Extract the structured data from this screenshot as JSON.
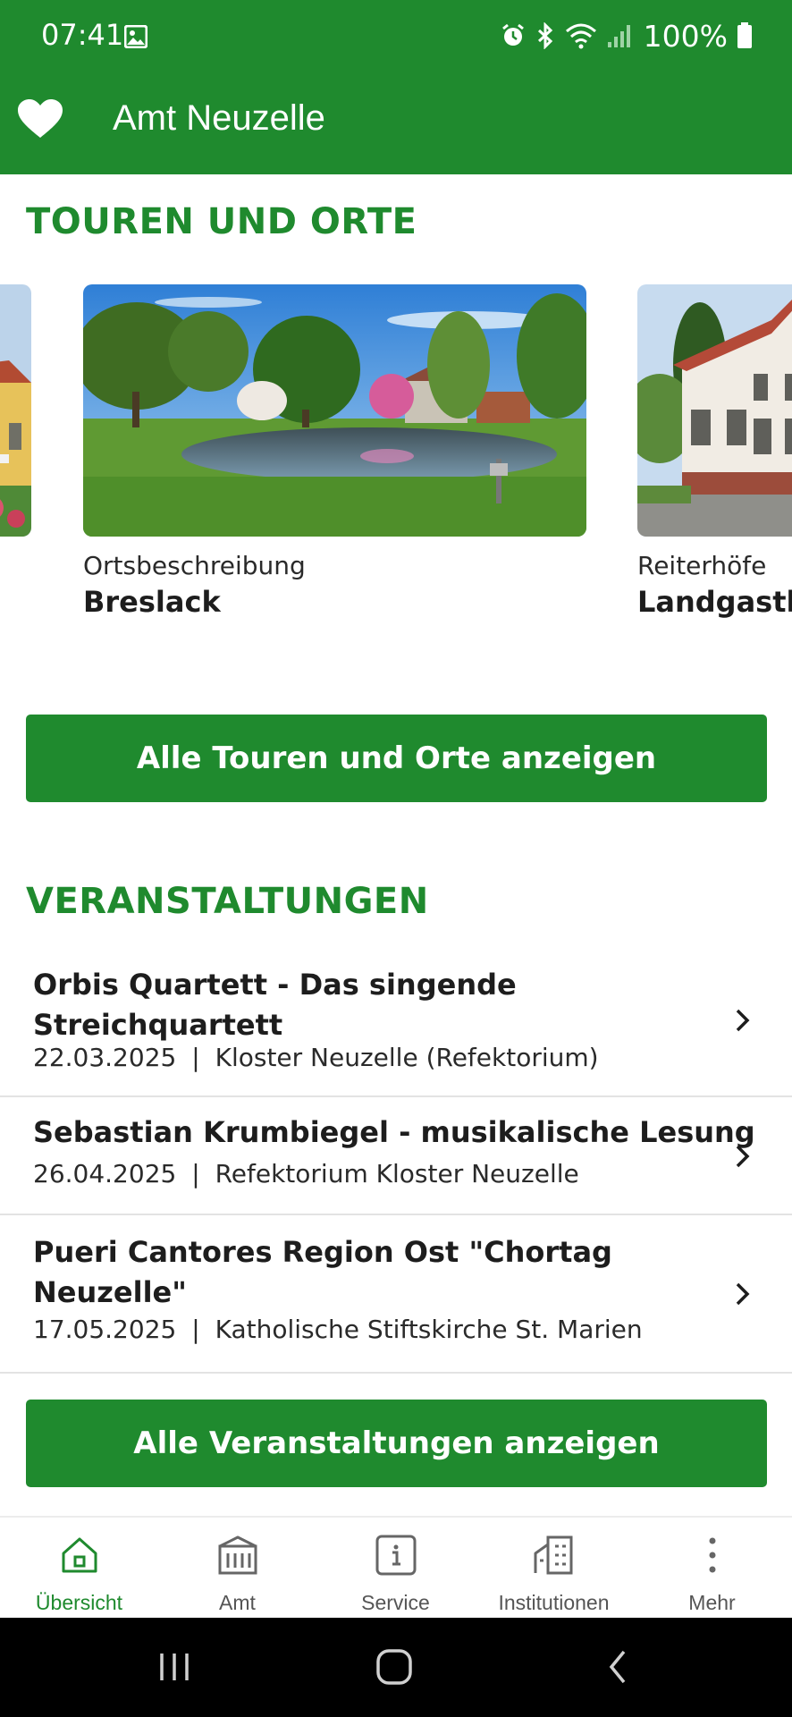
{
  "status_bar": {
    "time": "07:41",
    "battery": "100%"
  },
  "app_bar": {
    "title": "Amt Neuzelle",
    "favorite_icon": "heart-icon"
  },
  "tours_section": {
    "heading": "TOUREN UND ORTE",
    "cards": [
      {
        "category": "",
        "name": ""
      },
      {
        "category": "Ortsbeschreibung",
        "name": "Breslack"
      },
      {
        "category": "Reiterhöfe",
        "name": "Landgasthof"
      }
    ],
    "all_button": "Alle Touren und Orte anzeigen"
  },
  "events_section": {
    "heading": "VERANSTALTUNGEN",
    "items": [
      {
        "title": "Orbis Quartett - Das singende Streichquartett",
        "date": "22.03.2025",
        "location": "Kloster Neuzelle (Refektorium)"
      },
      {
        "title": "Sebastian Krumbiegel - musikalische Lesung",
        "date": "26.04.2025",
        "location": "Refektorium Kloster Neuzelle"
      },
      {
        "title": "Pueri Cantores Region Ost \"Chortag Neuzelle\"",
        "date": "17.05.2025",
        "location": "Katholische Stiftskirche St. Marien"
      }
    ],
    "separator": "|",
    "all_button": "Alle Veranstaltungen anzeigen"
  },
  "bottom_nav": {
    "items": [
      {
        "label": "Übersicht",
        "icon": "home-icon",
        "active": true
      },
      {
        "label": "Amt",
        "icon": "town-hall-icon",
        "active": false
      },
      {
        "label": "Service",
        "icon": "info-icon",
        "active": false
      },
      {
        "label": "Institutionen",
        "icon": "buildings-icon",
        "active": false
      },
      {
        "label": "Mehr",
        "icon": "more-vertical-icon",
        "active": false
      }
    ]
  },
  "colors": {
    "brand_green": "#1f8a2e",
    "text": "#1d1d1d",
    "divider": "#e3e3e3"
  }
}
